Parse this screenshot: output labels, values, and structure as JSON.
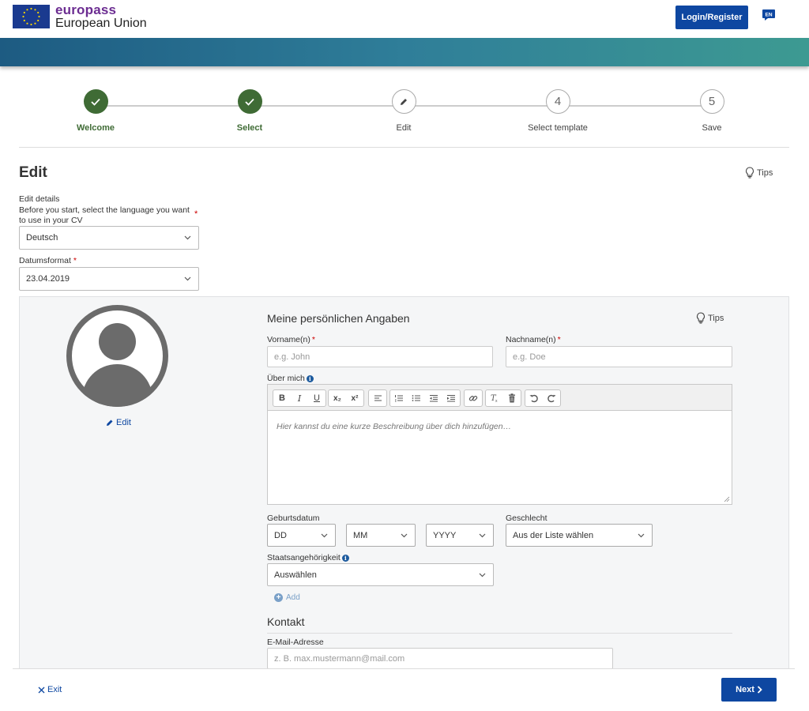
{
  "header": {
    "brand_top": "europass",
    "brand_bottom": "European Union",
    "login_label": "Login/Register",
    "language_badge": "EN"
  },
  "stepper": {
    "steps": [
      {
        "label": "Welcome",
        "state": "done",
        "symbol": "✓"
      },
      {
        "label": "Select",
        "state": "done",
        "symbol": "✓"
      },
      {
        "label": "Edit",
        "state": "current",
        "symbol": "pencil-icon"
      },
      {
        "label": "Select template",
        "state": "todo",
        "symbol": "4"
      },
      {
        "label": "Save",
        "state": "todo",
        "symbol": "5"
      }
    ]
  },
  "edit": {
    "title": "Edit",
    "tips_label": "Tips",
    "details_label": "Edit details",
    "language_instruction": "Before you start, select the language you want to use in your CV",
    "language_value": "Deutsch",
    "date_format_label": "Datumsformat",
    "date_format_value": "23.04.2019"
  },
  "personal": {
    "photo_edit_label": "Edit",
    "section_title": "Meine persönlichen Angaben",
    "tips_label": "Tips",
    "first_name_label": "Vorname(n)",
    "first_name_placeholder": "e.g. John",
    "last_name_label": "Nachname(n)",
    "last_name_placeholder": "e.g. Doe",
    "about_label": "Über mich",
    "about_placeholder": "Hier kannst du eine kurze Beschreibung über dich hinzufügen…",
    "birthdate_label": "Geburtsdatum",
    "day_value": "DD",
    "month_value": "MM",
    "year_value": "YYYY",
    "gender_label": "Geschlecht",
    "gender_value": "Aus der Liste wählen",
    "nationality_label": "Staatsangehörigkeit",
    "nationality_value": "Auswählen",
    "add_label": "Add"
  },
  "contact": {
    "section_title": "Kontakt",
    "email_label": "E-Mail-Adresse",
    "email_placeholder": "z. B. max.mustermann@mail.com"
  },
  "editor_toolbar": {
    "bold": "B",
    "italic": "I",
    "underline": "U",
    "subscript": "x₂",
    "superscript": "x²"
  },
  "footer": {
    "exit_label": "Exit",
    "next_label": "Next"
  },
  "colors": {
    "primary": "#0e47a1",
    "step_done": "#3f6b35",
    "brand_purple": "#6b2c91"
  }
}
